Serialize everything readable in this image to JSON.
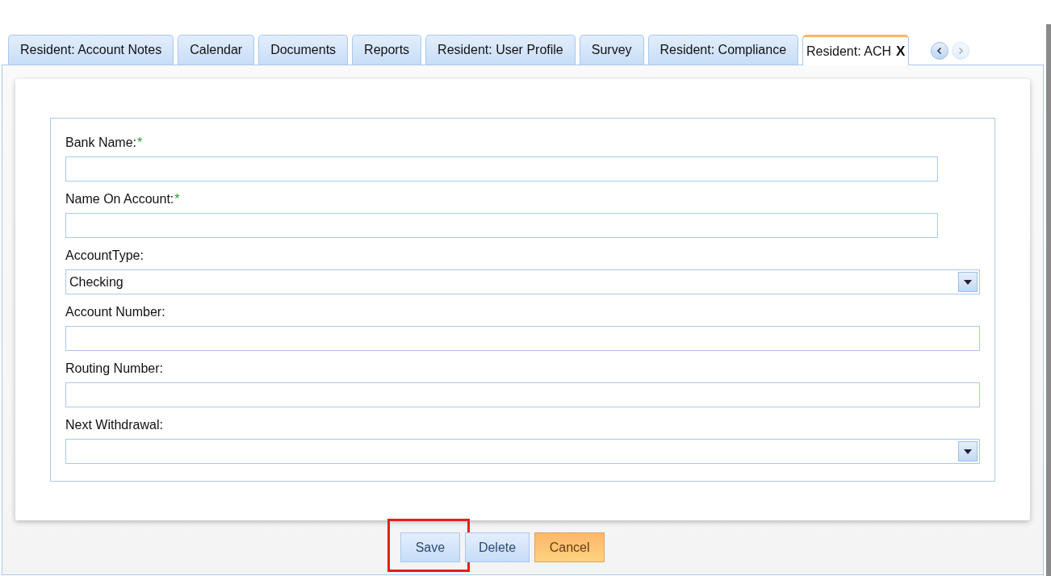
{
  "tabs": [
    {
      "label": "Resident: Account Notes",
      "selected": false
    },
    {
      "label": "Calendar",
      "selected": false
    },
    {
      "label": "Documents",
      "selected": false
    },
    {
      "label": "Reports",
      "selected": false
    },
    {
      "label": "Resident: User Profile",
      "selected": false
    },
    {
      "label": "Survey",
      "selected": false
    },
    {
      "label": "Resident: Compliance",
      "selected": false
    },
    {
      "label": "Resident: ACH",
      "selected": true,
      "close_label": "X"
    }
  ],
  "tab_scroll": {
    "prev_disabled": false,
    "next_disabled": true
  },
  "form": {
    "fields": [
      {
        "kind": "text",
        "label": "Bank Name:",
        "required_mark": "*"
      },
      {
        "kind": "text",
        "label": "Name On Account:",
        "required_mark": "*"
      },
      {
        "kind": "select",
        "label": "AccountType:",
        "value": "Checking"
      },
      {
        "kind": "text",
        "label": "Account Number:"
      },
      {
        "kind": "text",
        "label": "Routing Number:"
      },
      {
        "kind": "select",
        "label": "Next Withdrawal:"
      }
    ]
  },
  "buttons": [
    {
      "label": "Save",
      "kind": "default",
      "highlighted": true
    },
    {
      "label": "Delete",
      "kind": "default",
      "highlighted": false
    },
    {
      "label": "Cancel",
      "kind": "cancel",
      "highlighted": false
    }
  ]
}
